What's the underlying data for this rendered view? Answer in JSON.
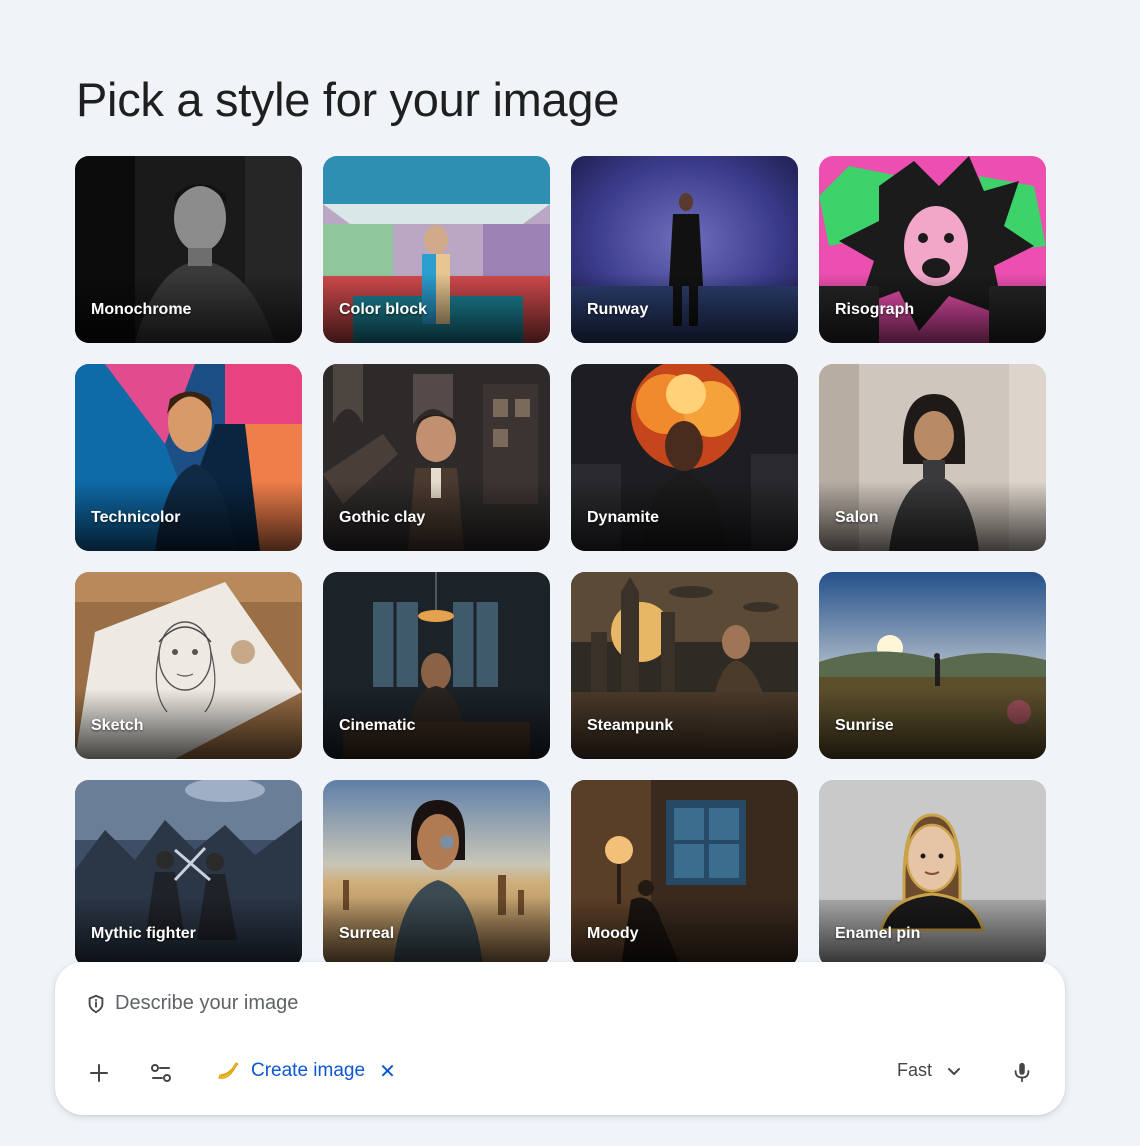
{
  "page": {
    "title": "Pick a style for your image"
  },
  "styles": [
    {
      "label": "Monochrome"
    },
    {
      "label": "Color block"
    },
    {
      "label": "Runway"
    },
    {
      "label": "Risograph"
    },
    {
      "label": "Technicolor"
    },
    {
      "label": "Gothic clay"
    },
    {
      "label": "Dynamite"
    },
    {
      "label": "Salon"
    },
    {
      "label": "Sketch"
    },
    {
      "label": "Cinematic"
    },
    {
      "label": "Steampunk"
    },
    {
      "label": "Sunrise"
    },
    {
      "label": "Mythic fighter"
    },
    {
      "label": "Surreal"
    },
    {
      "label": "Moody"
    },
    {
      "label": "Enamel pin"
    }
  ],
  "composer": {
    "placeholder": "Describe your image",
    "tool_chip": {
      "label": "Create image",
      "icon": "banana-icon"
    },
    "mode": "Fast",
    "icons": [
      "shield-icon",
      "plus-icon",
      "tools-icon",
      "close-icon",
      "chevron-down-icon",
      "mic-icon"
    ]
  },
  "colors": {
    "background": "#f0f4f9",
    "accent": "#0b57d0",
    "composer_bg": "#ffffff"
  }
}
